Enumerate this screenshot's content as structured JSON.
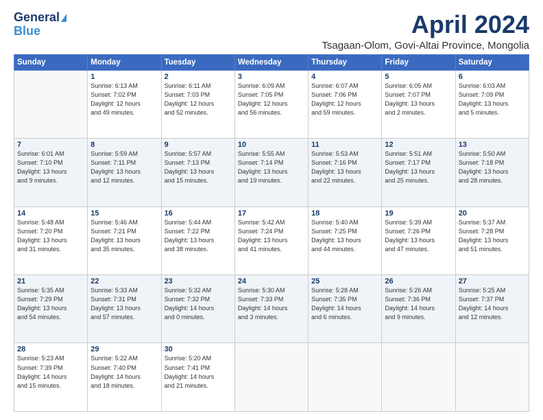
{
  "header": {
    "logo_line1": "General",
    "logo_line2": "Blue",
    "month_title": "April 2024",
    "location": "Tsagaan-Olom, Govi-Altai Province, Mongolia"
  },
  "weekdays": [
    "Sunday",
    "Monday",
    "Tuesday",
    "Wednesday",
    "Thursday",
    "Friday",
    "Saturday"
  ],
  "weeks": [
    [
      {
        "day": "",
        "info": ""
      },
      {
        "day": "1",
        "info": "Sunrise: 6:13 AM\nSunset: 7:02 PM\nDaylight: 12 hours\nand 49 minutes."
      },
      {
        "day": "2",
        "info": "Sunrise: 6:11 AM\nSunset: 7:03 PM\nDaylight: 12 hours\nand 52 minutes."
      },
      {
        "day": "3",
        "info": "Sunrise: 6:09 AM\nSunset: 7:05 PM\nDaylight: 12 hours\nand 56 minutes."
      },
      {
        "day": "4",
        "info": "Sunrise: 6:07 AM\nSunset: 7:06 PM\nDaylight: 12 hours\nand 59 minutes."
      },
      {
        "day": "5",
        "info": "Sunrise: 6:05 AM\nSunset: 7:07 PM\nDaylight: 13 hours\nand 2 minutes."
      },
      {
        "day": "6",
        "info": "Sunrise: 6:03 AM\nSunset: 7:09 PM\nDaylight: 13 hours\nand 5 minutes."
      }
    ],
    [
      {
        "day": "7",
        "info": "Sunrise: 6:01 AM\nSunset: 7:10 PM\nDaylight: 13 hours\nand 9 minutes."
      },
      {
        "day": "8",
        "info": "Sunrise: 5:59 AM\nSunset: 7:11 PM\nDaylight: 13 hours\nand 12 minutes."
      },
      {
        "day": "9",
        "info": "Sunrise: 5:57 AM\nSunset: 7:13 PM\nDaylight: 13 hours\nand 15 minutes."
      },
      {
        "day": "10",
        "info": "Sunrise: 5:55 AM\nSunset: 7:14 PM\nDaylight: 13 hours\nand 19 minutes."
      },
      {
        "day": "11",
        "info": "Sunrise: 5:53 AM\nSunset: 7:16 PM\nDaylight: 13 hours\nand 22 minutes."
      },
      {
        "day": "12",
        "info": "Sunrise: 5:51 AM\nSunset: 7:17 PM\nDaylight: 13 hours\nand 25 minutes."
      },
      {
        "day": "13",
        "info": "Sunrise: 5:50 AM\nSunset: 7:18 PM\nDaylight: 13 hours\nand 28 minutes."
      }
    ],
    [
      {
        "day": "14",
        "info": "Sunrise: 5:48 AM\nSunset: 7:20 PM\nDaylight: 13 hours\nand 31 minutes."
      },
      {
        "day": "15",
        "info": "Sunrise: 5:46 AM\nSunset: 7:21 PM\nDaylight: 13 hours\nand 35 minutes."
      },
      {
        "day": "16",
        "info": "Sunrise: 5:44 AM\nSunset: 7:22 PM\nDaylight: 13 hours\nand 38 minutes."
      },
      {
        "day": "17",
        "info": "Sunrise: 5:42 AM\nSunset: 7:24 PM\nDaylight: 13 hours\nand 41 minutes."
      },
      {
        "day": "18",
        "info": "Sunrise: 5:40 AM\nSunset: 7:25 PM\nDaylight: 13 hours\nand 44 minutes."
      },
      {
        "day": "19",
        "info": "Sunrise: 5:39 AM\nSunset: 7:26 PM\nDaylight: 13 hours\nand 47 minutes."
      },
      {
        "day": "20",
        "info": "Sunrise: 5:37 AM\nSunset: 7:28 PM\nDaylight: 13 hours\nand 51 minutes."
      }
    ],
    [
      {
        "day": "21",
        "info": "Sunrise: 5:35 AM\nSunset: 7:29 PM\nDaylight: 13 hours\nand 54 minutes."
      },
      {
        "day": "22",
        "info": "Sunrise: 5:33 AM\nSunset: 7:31 PM\nDaylight: 13 hours\nand 57 minutes."
      },
      {
        "day": "23",
        "info": "Sunrise: 5:32 AM\nSunset: 7:32 PM\nDaylight: 14 hours\nand 0 minutes."
      },
      {
        "day": "24",
        "info": "Sunrise: 5:30 AM\nSunset: 7:33 PM\nDaylight: 14 hours\nand 3 minutes."
      },
      {
        "day": "25",
        "info": "Sunrise: 5:28 AM\nSunset: 7:35 PM\nDaylight: 14 hours\nand 6 minutes."
      },
      {
        "day": "26",
        "info": "Sunrise: 5:26 AM\nSunset: 7:36 PM\nDaylight: 14 hours\nand 9 minutes."
      },
      {
        "day": "27",
        "info": "Sunrise: 5:25 AM\nSunset: 7:37 PM\nDaylight: 14 hours\nand 12 minutes."
      }
    ],
    [
      {
        "day": "28",
        "info": "Sunrise: 5:23 AM\nSunset: 7:39 PM\nDaylight: 14 hours\nand 15 minutes."
      },
      {
        "day": "29",
        "info": "Sunrise: 5:22 AM\nSunset: 7:40 PM\nDaylight: 14 hours\nand 18 minutes."
      },
      {
        "day": "30",
        "info": "Sunrise: 5:20 AM\nSunset: 7:41 PM\nDaylight: 14 hours\nand 21 minutes."
      },
      {
        "day": "",
        "info": ""
      },
      {
        "day": "",
        "info": ""
      },
      {
        "day": "",
        "info": ""
      },
      {
        "day": "",
        "info": ""
      }
    ]
  ]
}
